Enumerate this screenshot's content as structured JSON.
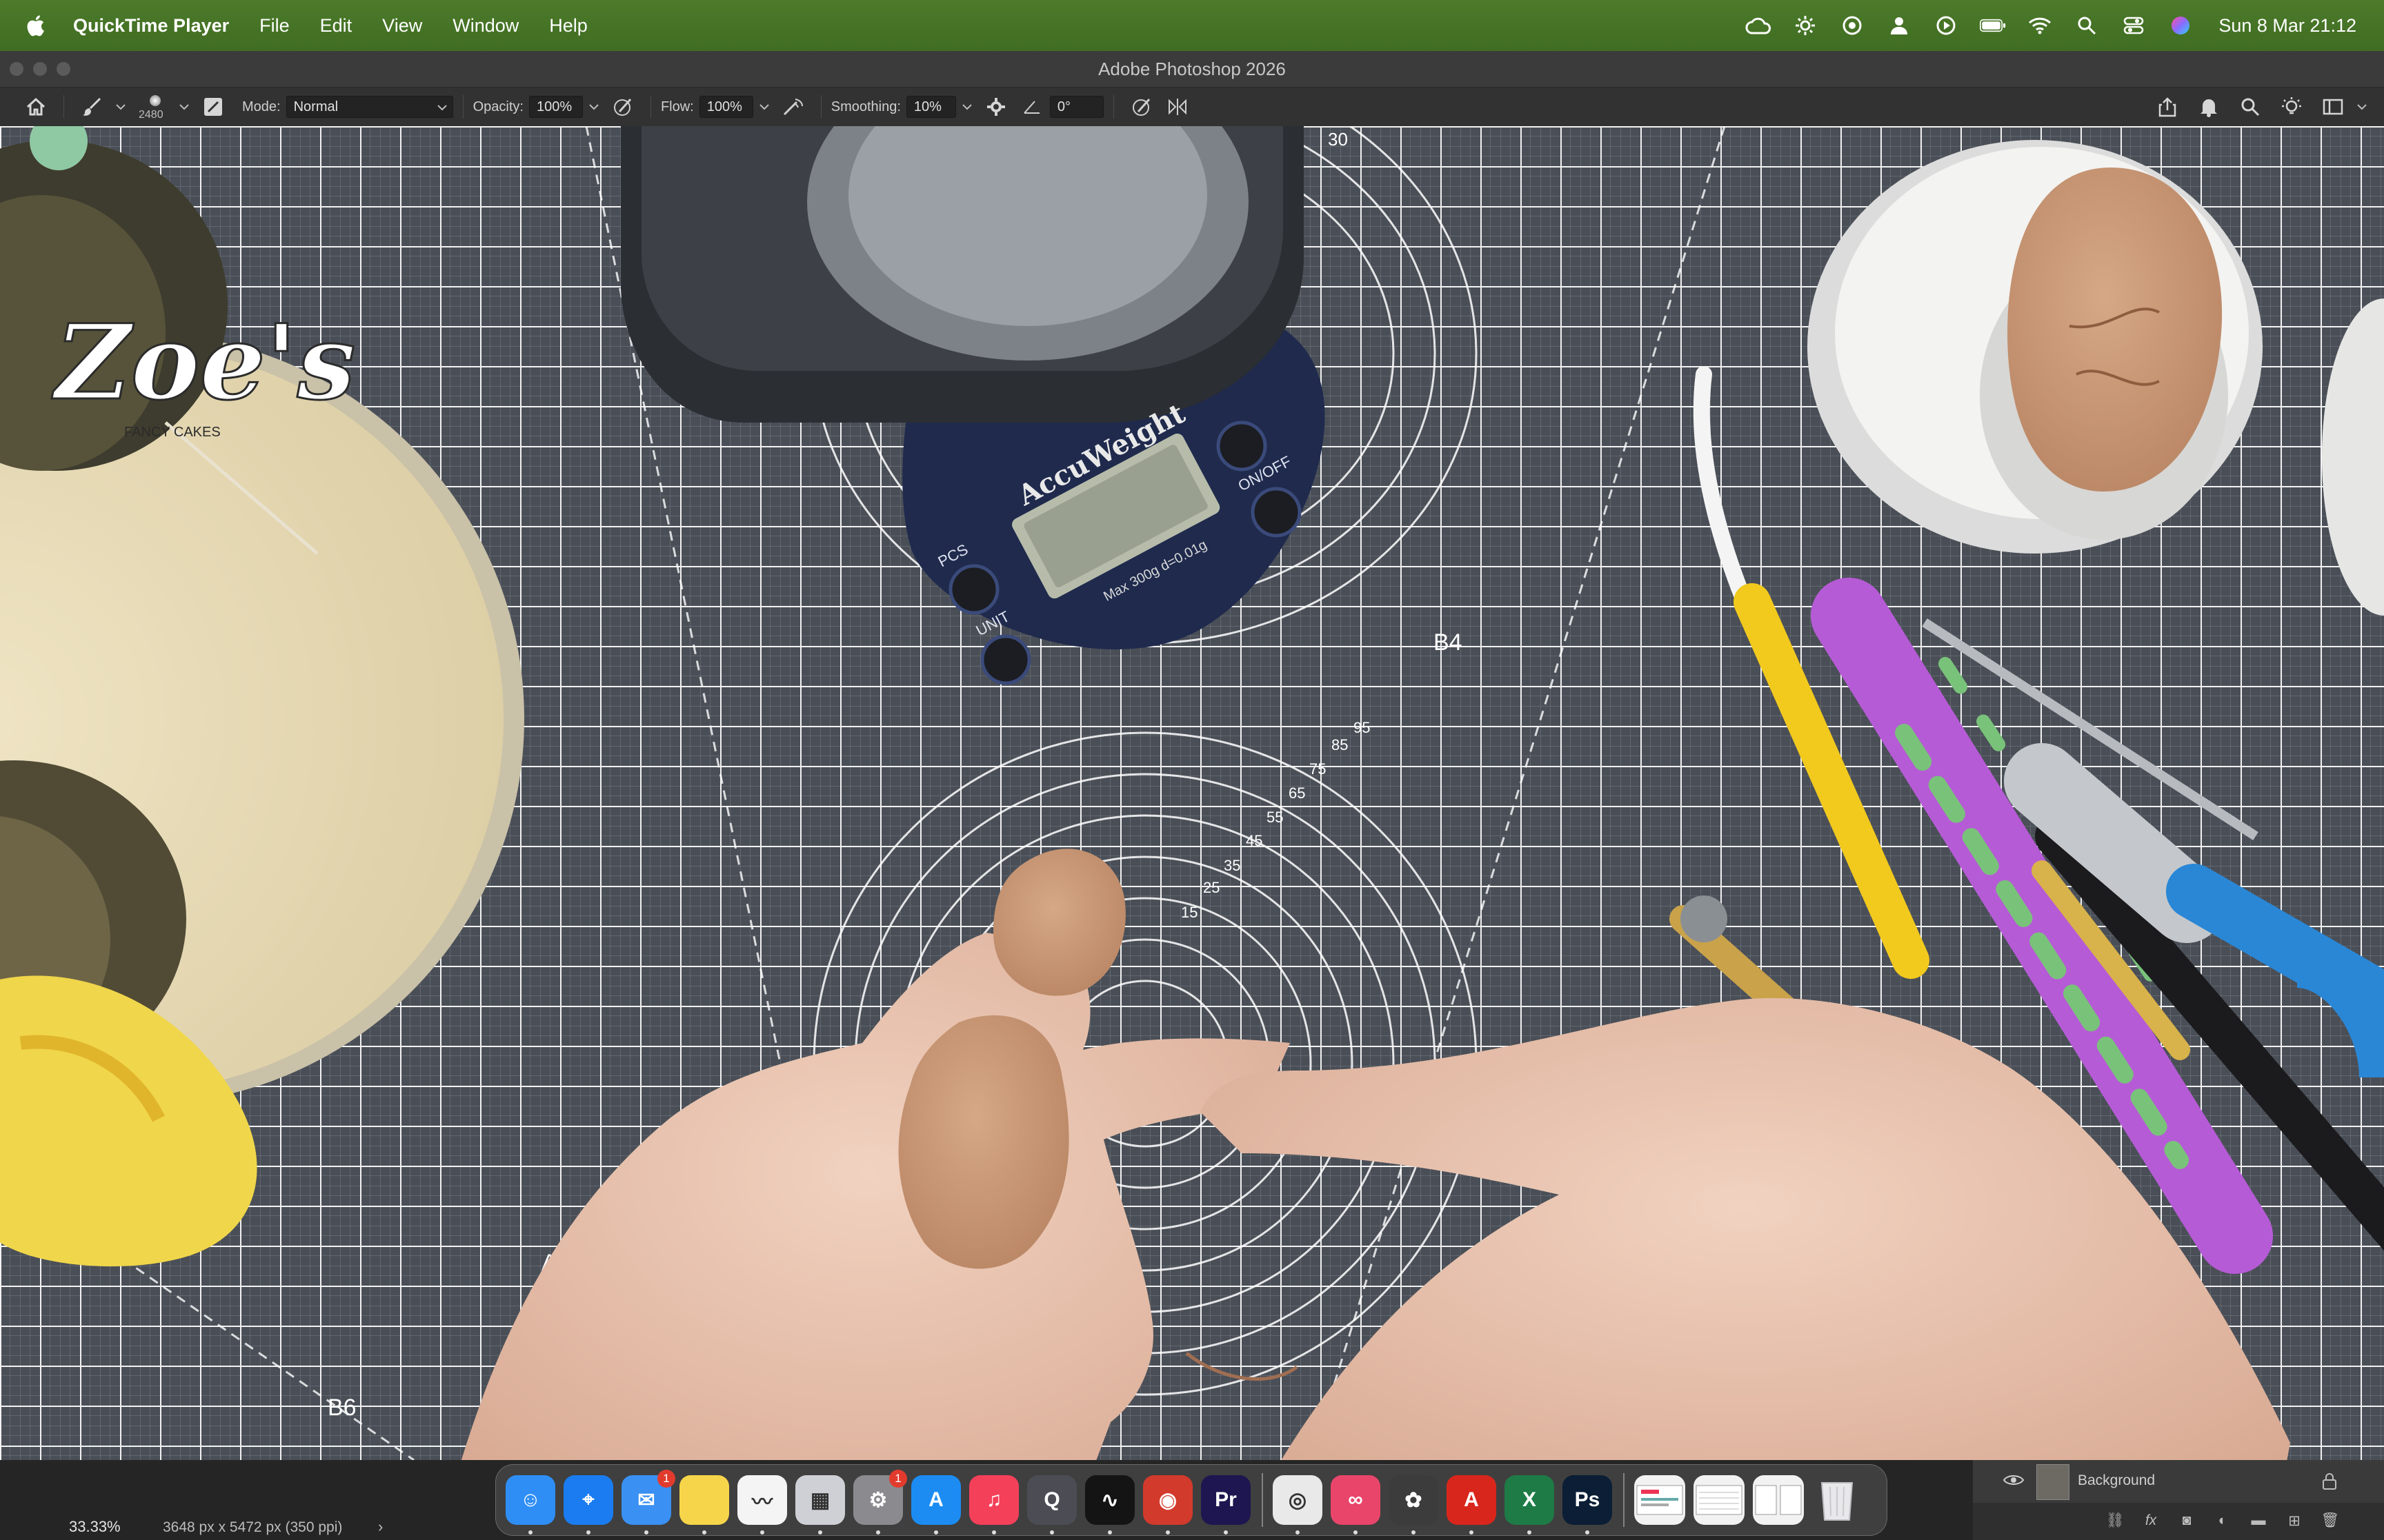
{
  "menubar": {
    "app_name": "QuickTime Player",
    "menus": [
      "File",
      "Edit",
      "View",
      "Window",
      "Help"
    ],
    "clock": "Sun 8 Mar  21:12",
    "status_icons": [
      "creative-cloud-icon",
      "settings-icon",
      "screen-record-icon",
      "user-icon",
      "play-icon",
      "battery-icon",
      "wifi-icon",
      "spotlight-icon",
      "control-center-icon",
      "siri-icon"
    ]
  },
  "window": {
    "title": "Adobe Photoshop 2026"
  },
  "options_bar": {
    "brush_size": "2480",
    "mode_label": "Mode:",
    "mode_value": "Normal",
    "opacity_label": "Opacity:",
    "opacity_value": "100%",
    "flow_label": "Flow:",
    "flow_value": "100%",
    "smoothing_label": "Smoothing:",
    "smoothing_value": "10%",
    "angle_value": "0°"
  },
  "canvas": {
    "logo_text": "Zoe's",
    "logo_subtext": "FANCY CAKES",
    "scale_brand": "AccuWeight",
    "scale_max": "Max 300g  d=0.01g",
    "scale_buttons": [
      "PCS",
      "UNIT",
      "ON/OFF"
    ],
    "mat_labels": [
      "B4",
      "A5",
      "B6",
      "30"
    ],
    "mat_numbers": [
      "95",
      "85",
      "75",
      "65",
      "55",
      "45",
      "35",
      "25",
      "15"
    ]
  },
  "status_bar": {
    "zoom": "33.33%",
    "doc_info": "3648 px x 5472 px (350 ppi)",
    "chevron": "›"
  },
  "layers_panel": {
    "layer_name": "Background"
  },
  "dock": {
    "apps": [
      {
        "name": "Finder",
        "glyph": "☺",
        "color": "#2f8ef5",
        "badge": ""
      },
      {
        "name": "Safari",
        "glyph": "⌖",
        "color": "#1a7cf0",
        "badge": ""
      },
      {
        "name": "Mail",
        "glyph": "✉",
        "color": "#3a90f3",
        "badge": "1"
      },
      {
        "name": "Notes",
        "glyph": "",
        "color": "#f7d54a",
        "badge": ""
      },
      {
        "name": "Freeform",
        "glyph": "〰",
        "color": "#f4f4f4",
        "badge": ""
      },
      {
        "name": "Launchpad",
        "glyph": "▦",
        "color": "#cfcfd6",
        "badge": ""
      },
      {
        "name": "System Settings",
        "glyph": "⚙",
        "color": "#8a8a8f",
        "badge": "1"
      },
      {
        "name": "App Store",
        "glyph": "A",
        "color": "#1c8cf2",
        "badge": ""
      },
      {
        "name": "Music",
        "glyph": "♫",
        "color": "#f5405a",
        "badge": ""
      },
      {
        "name": "QuickTime Player",
        "glyph": "Q",
        "color": "#4c4c55",
        "badge": ""
      },
      {
        "name": "Audio Editor",
        "glyph": "∿",
        "color": "#141414",
        "badge": ""
      },
      {
        "name": "Photo Booth",
        "glyph": "◉",
        "color": "#d23a2c",
        "badge": ""
      },
      {
        "name": "Premiere Pro",
        "glyph": "Pr",
        "color": "#1d1650",
        "badge": ""
      },
      {
        "name": "Chrome",
        "glyph": "◎",
        "color": "#e9e9e9",
        "badge": ""
      },
      {
        "name": "Creative Cloud",
        "glyph": "∞",
        "color": "#e9456a",
        "badge": ""
      },
      {
        "name": "Cyberduck",
        "glyph": "✿",
        "color": "#3c3c3c",
        "badge": ""
      },
      {
        "name": "Acrobat",
        "glyph": "A",
        "color": "#d9261c",
        "badge": ""
      },
      {
        "name": "Excel",
        "glyph": "X",
        "color": "#1e7b45",
        "badge": ""
      },
      {
        "name": "Photoshop",
        "glyph": "Ps",
        "color": "#0b1e36",
        "badge": ""
      }
    ],
    "stacks": [
      "Downloads",
      "Documents",
      "Desktop"
    ],
    "trash_label": "Trash"
  }
}
